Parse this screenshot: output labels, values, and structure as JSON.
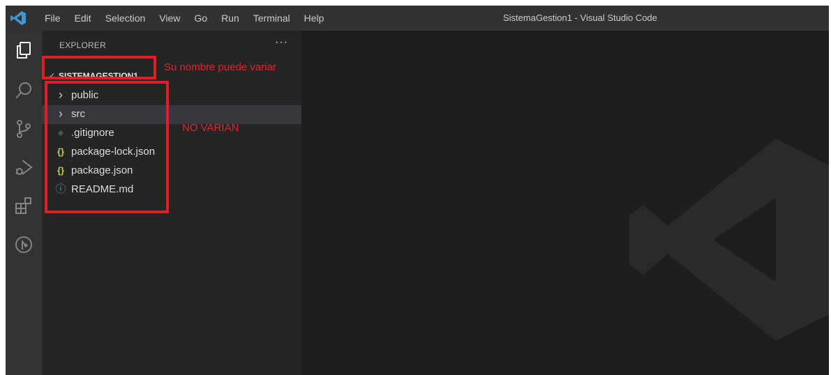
{
  "menu": [
    "File",
    "Edit",
    "Selection",
    "View",
    "Go",
    "Run",
    "Terminal",
    "Help"
  ],
  "window_title": "SistemaGestion1 - Visual Studio Code",
  "activity_bar": [
    "explorer-icon",
    "search-icon",
    "source-control-icon",
    "run-debug-icon",
    "extensions-icon",
    "git-graph-icon"
  ],
  "explorer": {
    "title": "EXPLORER",
    "more": "···",
    "root": {
      "chevron": "✓",
      "name": "SISTEMAGESTION1"
    },
    "items": [
      {
        "type": "folder",
        "icon": "chevron-right-icon",
        "glyph": "›",
        "label": "public"
      },
      {
        "type": "folder",
        "icon": "chevron-right-icon",
        "glyph": "›",
        "label": "src",
        "hover": true
      },
      {
        "type": "file",
        "icon": "git-file-icon",
        "glyph": "◆",
        "label": ".gitignore"
      },
      {
        "type": "file",
        "icon": "json-file-icon",
        "glyph": "{}",
        "label": "package-lock.json"
      },
      {
        "type": "file",
        "icon": "json-file-icon",
        "glyph": "{}",
        "label": "package.json"
      },
      {
        "type": "file",
        "icon": "info-file-icon",
        "glyph": "ⓘ",
        "label": "README.md"
      }
    ]
  },
  "annotations": {
    "name_note": "Su nombre puede variar",
    "fixed_note": "NO VARIAN"
  },
  "colors": {
    "annotation": "#e01e24",
    "json_icon": "#cbcb41",
    "info_icon": "#519aba",
    "git_icon": "#41535b",
    "vscode_blue": "#3b99d4"
  }
}
